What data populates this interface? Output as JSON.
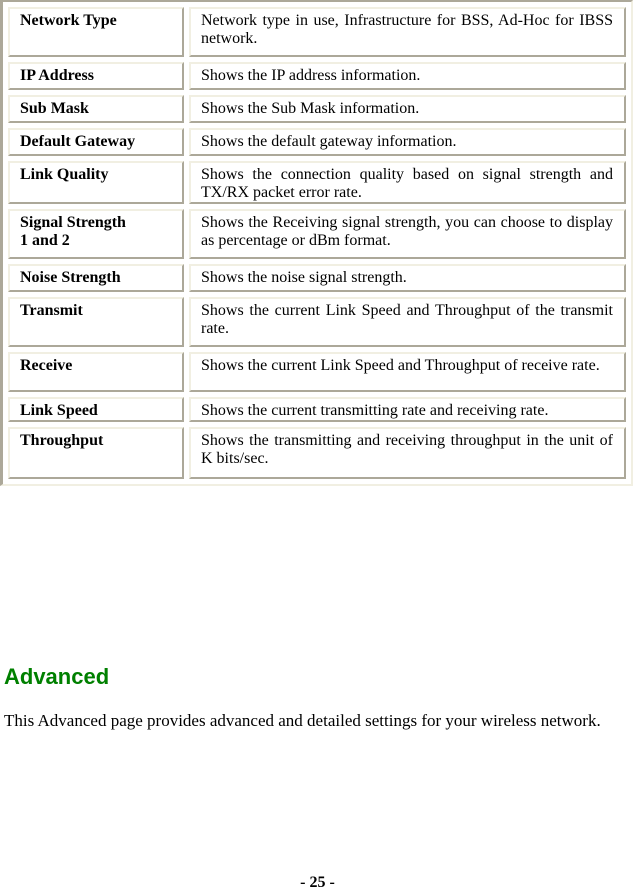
{
  "table": {
    "rows": [
      {
        "term": "Network Type",
        "description": "Network type in use, Infrastructure for BSS, Ad-Hoc for IBSS network."
      },
      {
        "term": "IP Address",
        "description": "Shows the IP address information."
      },
      {
        "term": "Sub Mask",
        "description": "Shows the Sub Mask information."
      },
      {
        "term": "Default Gateway",
        "description": "Shows the default gateway information."
      },
      {
        "term": "Link Quality",
        "description": "Shows the connection quality based on signal strength and TX/RX packet error rate."
      },
      {
        "term_line1": "Signal Strength",
        "term_line2": "1 and 2",
        "description": "Shows the Receiving signal strength, you can choose to display as percentage or dBm format."
      },
      {
        "term": "Noise Strength",
        "description": "Shows the noise signal strength."
      },
      {
        "term": "Transmit",
        "description": "Shows the current Link Speed and Throughput of the transmit rate."
      },
      {
        "term": "Receive",
        "description": "Shows the current Link Speed and Throughput of receive rate."
      },
      {
        "term": "Link Speed",
        "description": "Shows the current transmitting rate and receiving rate."
      },
      {
        "term": "Throughput",
        "description": "Shows the transmitting and receiving throughput in the unit of K bits/sec."
      }
    ]
  },
  "section": {
    "heading": "Advanced",
    "heading_color": "#008000",
    "body": "This Advanced page provides advanced and detailed settings for your wireless network."
  },
  "footer": {
    "page_number": "- 25 -"
  }
}
